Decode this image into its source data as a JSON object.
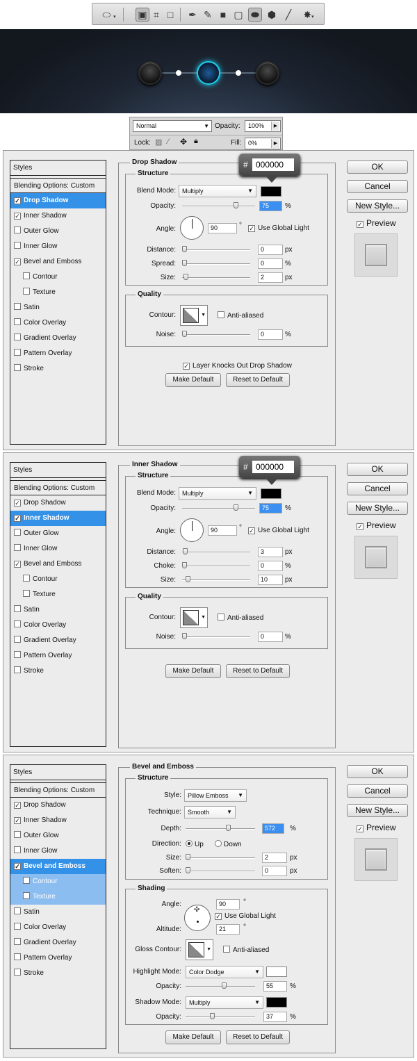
{
  "layers_panel": {
    "blend_mode": "Normal",
    "opacity_label": "Opacity:",
    "opacity_value": "100%",
    "lock_label": "Lock:",
    "fill_label": "Fill:",
    "fill_value": "0%"
  },
  "dialog_common": {
    "styles_header": "Styles",
    "blending_options": "Blending Options: Custom",
    "items": [
      "Drop Shadow",
      "Inner Shadow",
      "Outer Glow",
      "Inner Glow",
      "Bevel and Emboss",
      "Contour",
      "Texture",
      "Satin",
      "Color Overlay",
      "Gradient Overlay",
      "Pattern Overlay",
      "Stroke"
    ],
    "ok": "OK",
    "cancel": "Cancel",
    "new_style": "New Style...",
    "preview": "Preview",
    "make_default": "Make Default",
    "reset_default": "Reset to Default",
    "structure": "Structure",
    "quality": "Quality",
    "blend_mode_label": "Blend Mode:",
    "opacity_label": "Opacity:",
    "angle_label": "Angle:",
    "use_global_light": "Use Global Light",
    "size_label": "Size:",
    "contour_label": "Contour:",
    "anti_aliased": "Anti-aliased",
    "noise_label": "Noise:",
    "percent": "%",
    "px": "px",
    "degree": "°",
    "hash": "#"
  },
  "drop_shadow": {
    "title": "Drop Shadow",
    "blend_mode": "Multiply",
    "color_hex": "000000",
    "opacity": "75",
    "angle": "90",
    "distance_label": "Distance:",
    "distance": "0",
    "spread_label": "Spread:",
    "spread": "0",
    "size": "2",
    "noise": "0",
    "layer_knocks": "Layer Knocks Out Drop Shadow"
  },
  "inner_shadow": {
    "title": "Inner Shadow",
    "blend_mode": "Multiply",
    "color_hex": "000000",
    "opacity": "75",
    "angle": "90",
    "distance_label": "Distance:",
    "distance": "3",
    "choke_label": "Choke:",
    "choke": "0",
    "size": "10",
    "noise": "0"
  },
  "bevel_emboss": {
    "title": "Bevel and Emboss",
    "style_label": "Style:",
    "style": "Pillow Emboss",
    "technique_label": "Technique:",
    "technique": "Smooth",
    "depth_label": "Depth:",
    "depth": "572",
    "direction_label": "Direction:",
    "up": "Up",
    "down": "Down",
    "size": "2",
    "soften_label": "Soften:",
    "soften": "0",
    "shading": "Shading",
    "altitude_label": "Altitude:",
    "angle": "90",
    "altitude": "21",
    "gloss_contour_label": "Gloss Contour:",
    "highlight_mode_label": "Highlight Mode:",
    "highlight_mode": "Color Dodge",
    "highlight_opacity": "55",
    "shadow_mode_label": "Shadow Mode:",
    "shadow_mode": "Multiply",
    "shadow_opacity": "37"
  },
  "colors": {
    "selected": "#3391e8",
    "sub_selected": "#8cbdf0",
    "glow": "#1fd0f0"
  }
}
